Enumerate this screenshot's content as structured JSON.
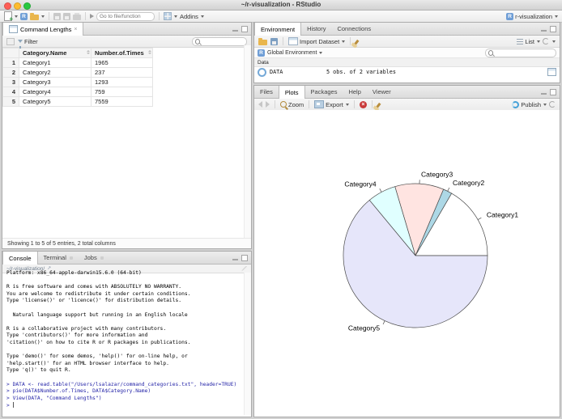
{
  "window": {
    "title": "~/r-visualization - RStudio",
    "project_label": "r-visualization"
  },
  "icons": {
    "close": "×",
    "external_link": "↗",
    "search_hint": ""
  },
  "main_toolbar": {
    "goto_placeholder": "Go to file/function",
    "addins_label": "Addins"
  },
  "data_viewer": {
    "tab_label": "Command Lengths",
    "filter_label": "Filter",
    "columns": [
      "Category.Name",
      "Number.of.Times"
    ],
    "rows": [
      [
        "1",
        "Category1",
        "1965"
      ],
      [
        "2",
        "Category2",
        "237"
      ],
      [
        "3",
        "Category3",
        "1293"
      ],
      [
        "4",
        "Category4",
        "759"
      ],
      [
        "5",
        "Category5",
        "7559"
      ]
    ],
    "status": "Showing 1 to 5 of 5 entries, 2 total columns"
  },
  "console": {
    "tabs": [
      "Console",
      "Terminal",
      "Jobs"
    ],
    "active_tab": 0,
    "path": "~/r-visualization/",
    "lines": [
      {
        "c": "out",
        "t": "Platform: x86_64-apple-darwin15.6.0 (64-bit)"
      },
      {
        "c": "out",
        "t": ""
      },
      {
        "c": "out",
        "t": "R is free software and comes with ABSOLUTELY NO WARRANTY."
      },
      {
        "c": "out",
        "t": "You are welcome to redistribute it under certain conditions."
      },
      {
        "c": "out",
        "t": "Type 'license()' or 'licence()' for distribution details."
      },
      {
        "c": "out",
        "t": ""
      },
      {
        "c": "out",
        "t": "  Natural language support but running in an English locale"
      },
      {
        "c": "out",
        "t": ""
      },
      {
        "c": "out",
        "t": "R is a collaborative project with many contributors."
      },
      {
        "c": "out",
        "t": "Type 'contributors()' for more information and"
      },
      {
        "c": "out",
        "t": "'citation()' on how to cite R or R packages in publications."
      },
      {
        "c": "out",
        "t": ""
      },
      {
        "c": "out",
        "t": "Type 'demo()' for some demos, 'help()' for on-line help, or"
      },
      {
        "c": "out",
        "t": "'help.start()' for an HTML browser interface to help."
      },
      {
        "c": "out",
        "t": "Type 'q()' to quit R."
      },
      {
        "c": "out",
        "t": ""
      },
      {
        "c": "in",
        "t": "> DATA <- read.table(\"/Users/lsalazar/command_categories.txt\", header=TRUE)"
      },
      {
        "c": "in",
        "t": "> pie(DATA$Number.of.Times, DATA$Category.Name)"
      },
      {
        "c": "in",
        "t": "> View(DATA, \"Command Lengths\")"
      },
      {
        "c": "prompt",
        "t": "> "
      }
    ]
  },
  "environment": {
    "tabs": [
      "Environment",
      "History",
      "Connections"
    ],
    "active_tab": 0,
    "import_label": "Import Dataset",
    "list_label": "List",
    "scope_label": "Global Environment",
    "section_label": "Data",
    "objects": [
      {
        "name": "DATA",
        "summary": "5 obs. of 2 variables"
      }
    ]
  },
  "plots": {
    "tabs": [
      "Files",
      "Plots",
      "Packages",
      "Help",
      "Viewer"
    ],
    "active_tab": 1,
    "zoom_label": "Zoom",
    "export_label": "Export",
    "publish_label": "Publish"
  },
  "chart_data": {
    "type": "pie",
    "categories": [
      "Category1",
      "Category2",
      "Category3",
      "Category4",
      "Category5"
    ],
    "values": [
      1965,
      237,
      1293,
      759,
      7559
    ],
    "colors": [
      "#FFFFFF",
      "#ADD8E6",
      "#FFE4E1",
      "#E0FFFF",
      "#E6E6FA"
    ],
    "edge_color": "#4a4a4a",
    "start_angle_deg": 0,
    "direction": "counterclockwise",
    "title": "",
    "legend": "labels-around-pie"
  }
}
